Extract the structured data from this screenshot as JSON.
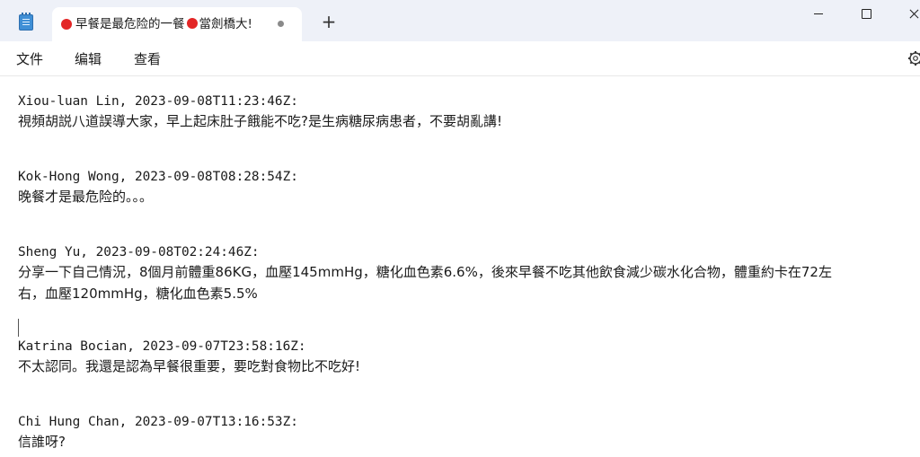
{
  "tab": {
    "title_part1": "早餐是最危险的一餐",
    "title_part2": "當劍橋大!"
  },
  "toolbar": {
    "new_tab_label": "+"
  },
  "menu": {
    "file": "文件",
    "edit": "编辑",
    "view": "查看"
  },
  "content": {
    "lines": [
      "Xiou-luan Lin, 2023-09-08T11:23:46Z:",
      "視頻胡説八道誤導大家，早上起床肚子餓能不吃?是生病糖尿病患者，不要胡亂講!",
      "Kok-Hong Wong, 2023-09-08T08:28:54Z:",
      "晚餐才是最危险的。。。",
      "Sheng Yu, 2023-09-08T02:24:46Z:",
      "分享一下自己情況，8個月前體重86KG，血壓145mmHg，糖化血色素6.6%，後來早餐不吃其他飲食減少碳水化合物，體重約卡在72左",
      "右，血壓120mmHg，糖化血色素5.5%",
      "Katrina Bocian, 2023-09-07T23:58:16Z:",
      "不太認同。我還是認為早餐很重要，要吃對食物比不吃好!",
      "Chi Hung Chan, 2023-09-07T13:16:53Z:",
      "信誰呀?"
    ]
  },
  "colors": {
    "titlebar": "#eef1f8",
    "tab_dot": "#e32626",
    "text": "#1a1a1a"
  }
}
